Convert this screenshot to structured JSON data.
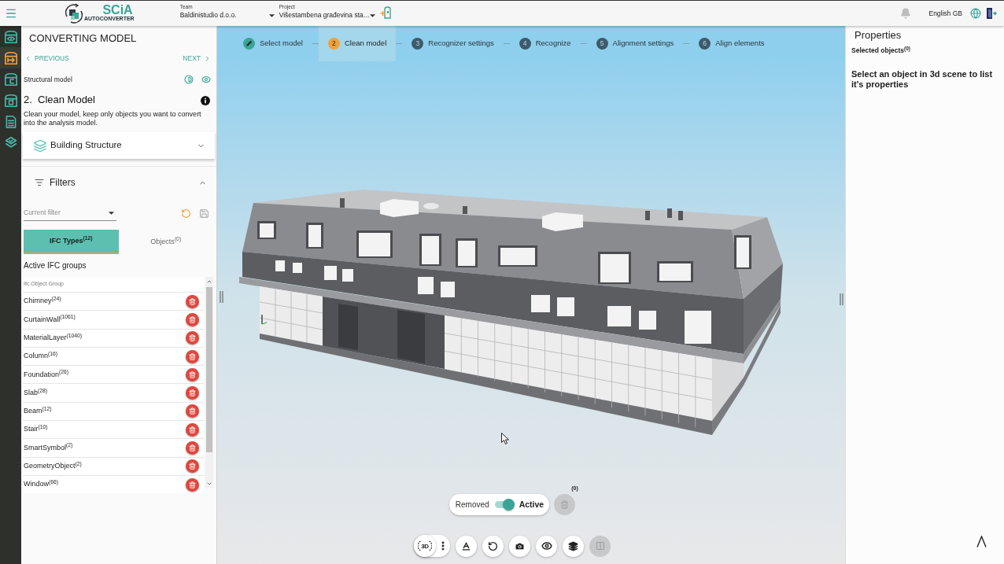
{
  "top_bar": {
    "logo": {
      "brand": "SCiA",
      "product": "AUTOCONVERTER"
    },
    "team": {
      "label": "Team",
      "value": "Baldinistudio d.o.o."
    },
    "project": {
      "label": "Project",
      "value": "Višestambena građevina sta…"
    },
    "language": "English GB"
  },
  "sidebar": {
    "items": [
      {
        "selected": false
      },
      {
        "selected": true
      },
      {
        "selected": false
      },
      {
        "selected": false
      },
      {
        "selected": false
      },
      {
        "selected": false
      }
    ]
  },
  "left_panel": {
    "title": "CONVERTING MODEL",
    "previous": "PREVIOUS",
    "next": "NEXT",
    "model_label": "Structural model",
    "step_number": "2.",
    "step_title": "Clean Model",
    "description": "Clean your model, keep only objects you want to convert into the analysis model.",
    "sections": [
      {
        "title": "Building Structure",
        "expanded": false
      },
      {
        "title": "Filters",
        "expanded": true
      }
    ],
    "filter": {
      "placeholder": "Current filter"
    },
    "tabs": [
      {
        "label": "IFC Types$^{(12)}$",
        "selected": true
      },
      {
        "label": "Objects$^{(0)}$",
        "selected": false
      }
    ],
    "groups_title": "Active IFC groups",
    "column": "Ifc Object Group",
    "groups": [
      {
        "name": "Chimney$^{(24)}$"
      },
      {
        "name": "CurtainWall$^{(1061)}$"
      },
      {
        "name": "MaterialLayer$^{(1040)}$"
      },
      {
        "name": "Column$^{(16)}$"
      },
      {
        "name": "Foundation$^{(26)}$"
      },
      {
        "name": "Slab$^{(28)}$"
      },
      {
        "name": "Beam$^{(12)}$"
      },
      {
        "name": "Stair$^{(10)}$"
      },
      {
        "name": "SmartSymbol$^{(2)}$"
      },
      {
        "name": "GeometryObject$^{(2)}$"
      },
      {
        "name": "Window$^{(66)}$"
      }
    ]
  },
  "viewport": {
    "steps": [
      {
        "label": "Select model",
        "completed": true,
        "selected": false
      },
      {
        "number": "2",
        "label": "Clean model",
        "completed": false,
        "selected": true
      },
      {
        "number": "3",
        "label": "Recognizer settings",
        "completed": false,
        "selected": false
      },
      {
        "number": "4",
        "label": "Recognize",
        "completed": false,
        "selected": false
      },
      {
        "number": "5",
        "label": "Alignment settings",
        "completed": false,
        "selected": false
      },
      {
        "number": "6",
        "label": "Align elements",
        "completed": false,
        "selected": false
      }
    ],
    "visibility_toggle": {
      "off_label": "Removed",
      "on_label": "Active",
      "on": true
    },
    "removed": {
      "count": "(0)",
      "disabled": true
    },
    "toolbar": {
      "view_label": "3D",
      "compare_disabled": true
    }
  },
  "properties": {
    "title": "Properties",
    "selected": "Selected objects$^{(0)}$",
    "hint": "Select an object in 3d scene to list it's properties"
  }
}
